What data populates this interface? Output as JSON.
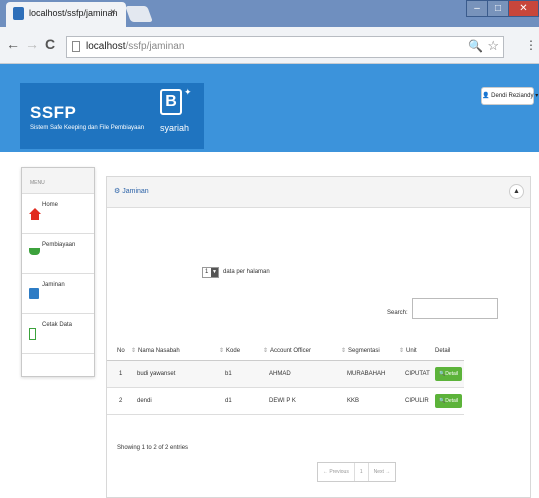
{
  "browser": {
    "tab_title": "localhost/ssfp/jaminan",
    "tab_close": "×",
    "window_minimize": "–",
    "window_maximize": "□",
    "window_close": "✕",
    "url_host": "localhost",
    "url_path": "/ssfp/jaminan",
    "nav_back": "←",
    "nav_forward": "→",
    "nav_reload": "C",
    "zoom_glyph": "🔍",
    "star_glyph": "☆",
    "menu_glyph": "⋮"
  },
  "header": {
    "logo_title": "SSFP",
    "logo_subtitle": "Sistem Safe Keeping dan File Pembiayaan",
    "brand_mark": "B",
    "brand_word": "syariah",
    "user_name": "Dendi Reziandy",
    "user_caret": "▾"
  },
  "sidebar": {
    "menu_label": "MENU",
    "items": [
      {
        "label": "Home",
        "icon": "home-icon"
      },
      {
        "label": "Pembiayaan",
        "icon": "cart-icon"
      },
      {
        "label": "Jaminan",
        "icon": "form-icon"
      },
      {
        "label": "Cetak Data",
        "icon": "print-icon"
      }
    ]
  },
  "panel": {
    "title": "Jaminan",
    "title_icon": "⚙",
    "collapse_glyph": "▲",
    "page_length_value": "1",
    "page_length_arrow": "▼",
    "page_length_text": "data per halaman",
    "search_label": "Search:",
    "search_value": ""
  },
  "table": {
    "columns": [
      "No",
      "Nama Nasabah",
      "Kode",
      "Account Officer",
      "Segmentasi",
      "Unit",
      "Detail"
    ],
    "sort_glyph": "⇕",
    "rows": [
      {
        "no": "1",
        "nama": "budi yawanset",
        "kode": "b1",
        "ao": "AHMAD",
        "seg": "MURABAHAH",
        "unit": "CIPUTAT",
        "detail": "Detail"
      },
      {
        "no": "2",
        "nama": "dendi",
        "kode": "d1",
        "ao": "DEWI P K",
        "seg": "KKB",
        "unit": "CIPULIR",
        "detail": "Detail"
      }
    ],
    "info": "Showing 1 to 2 of 2 entries",
    "pager": {
      "prev": "← Previous",
      "page": "1",
      "next": "Next →"
    }
  }
}
